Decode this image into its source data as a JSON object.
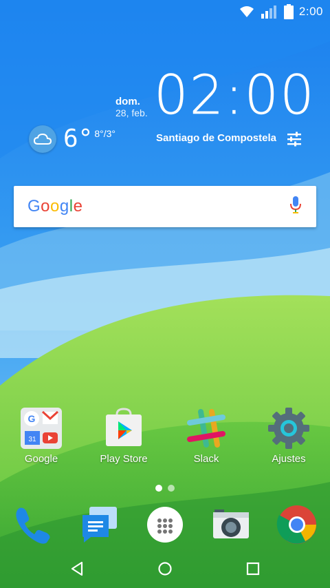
{
  "status_bar": {
    "time": "2:00",
    "icons": [
      "wifi-icon",
      "signal-icon",
      "battery-icon"
    ]
  },
  "clock_widget": {
    "day": "dom.",
    "date": "28, feb.",
    "time": "02:00",
    "temperature": "6°",
    "min_max": "8°/3°",
    "location": "Santiago de Compostela",
    "weather_icon": "cloud-icon",
    "settings_icon": "sliders-icon"
  },
  "search": {
    "logo_letters": [
      "G",
      "o",
      "o",
      "g",
      "l",
      "e"
    ],
    "mic_icon": "microphone-icon"
  },
  "apps": [
    {
      "label": "Google",
      "icon": "google-folder-icon"
    },
    {
      "label": "Play Store",
      "icon": "play-store-icon"
    },
    {
      "label": "Slack",
      "icon": "slack-icon"
    },
    {
      "label": "Ajustes",
      "icon": "settings-gear-icon"
    }
  ],
  "pages": {
    "count": 2,
    "active": 0
  },
  "dock": [
    {
      "icon": "phone-icon"
    },
    {
      "icon": "messages-icon"
    },
    {
      "icon": "app-drawer-icon"
    },
    {
      "icon": "camera-icon"
    },
    {
      "icon": "chrome-icon"
    }
  ],
  "navigation": [
    "back-icon",
    "home-icon",
    "recents-icon"
  ],
  "colors": {
    "sky": "#1f8ff0",
    "hill_light": "#8fd84a",
    "hill_dark": "#3fae36",
    "google_blue": "#4285f4",
    "google_red": "#ea4335",
    "google_yellow": "#fbbc05",
    "google_green": "#34a853"
  }
}
